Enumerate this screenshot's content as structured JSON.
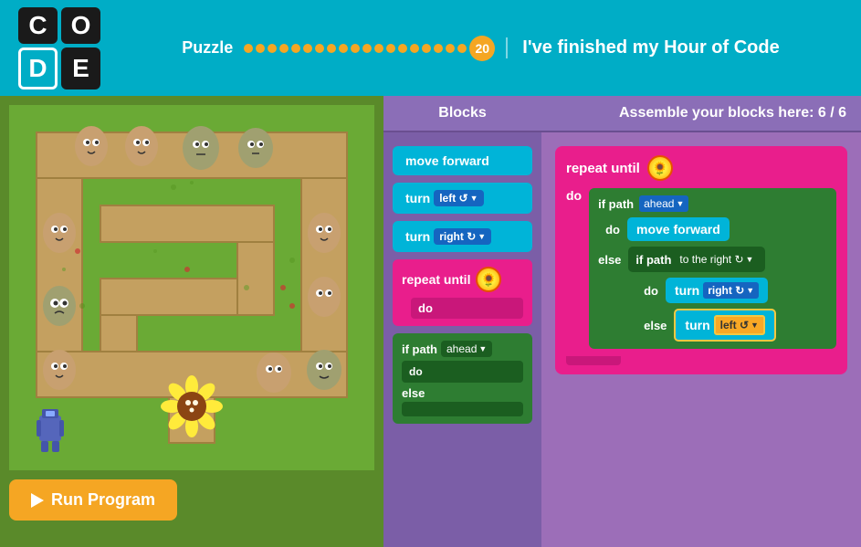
{
  "header": {
    "logo": {
      "cells": [
        "C",
        "O",
        "D",
        "E"
      ]
    },
    "puzzle_label": "Puzzle",
    "puzzle_number": "20",
    "finished_text": "I've finished my Hour of Code",
    "dots_total": 20
  },
  "blocks_panel": {
    "title": "Blocks",
    "blocks": [
      {
        "id": "move-forward",
        "label": "move forward",
        "type": "cyan"
      },
      {
        "id": "turn-left",
        "label": "turn",
        "dropdown": "left ↺",
        "type": "cyan"
      },
      {
        "id": "turn-right",
        "label": "turn",
        "dropdown": "right ↻",
        "type": "cyan"
      },
      {
        "id": "repeat-until",
        "label": "repeat until",
        "type": "pink"
      },
      {
        "id": "do",
        "label": "do",
        "type": "pink"
      },
      {
        "id": "if-path",
        "label": "if path",
        "dropdown": "ahead",
        "type": "green"
      },
      {
        "id": "do2",
        "label": "do",
        "type": "green"
      },
      {
        "id": "else",
        "label": "else",
        "type": "green"
      }
    ]
  },
  "assembly_panel": {
    "title": "Assemble your blocks here: 6 / 6",
    "repeat_label": "repeat until",
    "do_label": "do",
    "else_label": "else",
    "if_path_label": "if path",
    "ahead_label": "ahead",
    "to_the_right_label": "to the right ↻",
    "move_forward_label": "move forward",
    "turn_right_label": "turn right ↻",
    "turn_left_label": "turn left ↺"
  },
  "run_button": {
    "label": "Run Program"
  }
}
